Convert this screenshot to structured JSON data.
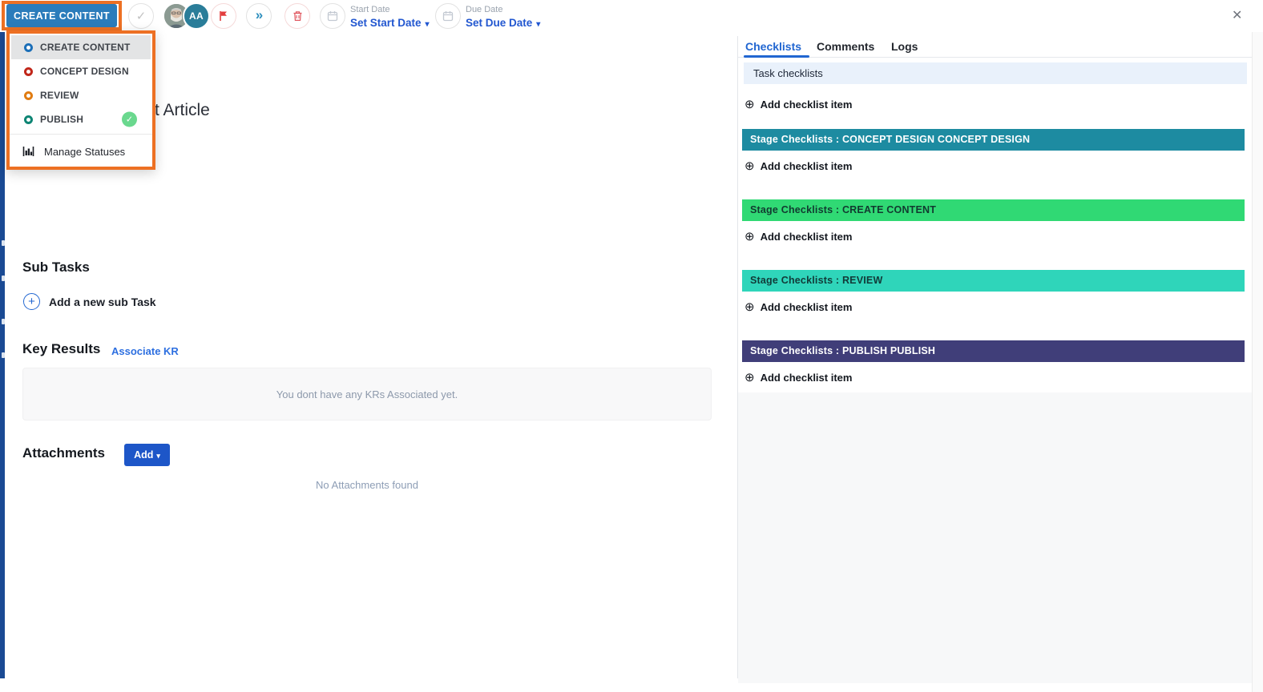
{
  "icons": {
    "check": "✓",
    "double_chevron": "»",
    "caret_down": "▾",
    "plus": "+",
    "circle_plus": "⊕",
    "close": "✕"
  },
  "colors": {
    "accent_blue": "#2166d1",
    "status_button_blue": "#2b7cbb",
    "link_blue": "#2257d0",
    "add_button_blue": "#1d56c8",
    "highlight_orange": "#ed7023",
    "sidebar_navy": "#1a4a94",
    "avatar_teal": "#2a7d99",
    "flag_red": "#e23c3c",
    "trash_red": "#e0575f"
  },
  "toolbar": {
    "status_button_label": "CREATE CONTENT",
    "avatar_initials": "AA",
    "start_date": {
      "label": "Start Date",
      "action": "Set Start Date"
    },
    "due_date": {
      "label": "Due Date",
      "action": "Set Due Date"
    }
  },
  "status_dropdown": {
    "items": [
      {
        "label": "CREATE CONTENT",
        "color": "#1c6fb8",
        "selected": true,
        "checked": false
      },
      {
        "label": "CONCEPT DESIGN",
        "color": "#c1271a",
        "selected": false,
        "checked": false
      },
      {
        "label": "REVIEW",
        "color": "#e07c12",
        "selected": false,
        "checked": false
      },
      {
        "label": "PUBLISH",
        "color": "#0e8574",
        "selected": false,
        "checked": true
      }
    ],
    "checked_color": "#6ad88e",
    "manage_label": "Manage Statuses"
  },
  "main": {
    "title_fragment": "t Article",
    "subtasks": {
      "heading": "Sub Tasks",
      "add_label": "Add a new sub Task"
    },
    "key_results": {
      "heading": "Key Results",
      "associate_link": "Associate KR",
      "empty_text": "You dont have any KRs Associated yet."
    },
    "attachments": {
      "heading": "Attachments",
      "add_button": "Add",
      "empty_text": "No Attachments found"
    }
  },
  "panel": {
    "tabs": [
      {
        "label": "Checklists",
        "active": true
      },
      {
        "label": "Comments",
        "active": false
      },
      {
        "label": "Logs",
        "active": false
      }
    ],
    "task_checklists_header": "Task checklists",
    "add_item_label": "Add checklist item",
    "stages": [
      {
        "title": "Stage Checklists : CONCEPT DESIGN CONCEPT DESIGN",
        "bg": "#1d8ba1",
        "fg": "#ffffff"
      },
      {
        "title": "Stage Checklists : CREATE CONTENT",
        "bg": "#30d974",
        "fg": "#123a30"
      },
      {
        "title": "Stage Checklists : REVIEW",
        "bg": "#2fd5ba",
        "fg": "#123a38"
      },
      {
        "title": "Stage Checklists : PUBLISH PUBLISH",
        "bg": "#403e79",
        "fg": "#ffffff"
      }
    ]
  }
}
